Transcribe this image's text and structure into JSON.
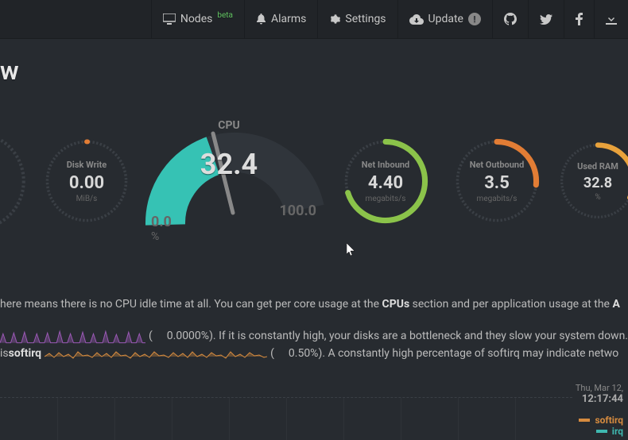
{
  "header": {
    "nodes": "Nodes",
    "nodes_badge": "beta",
    "alarms": "Alarms",
    "settings": "Settings",
    "update": "Update",
    "update_badge": "!"
  },
  "heading": "w",
  "gauges": {
    "disk_write": {
      "title": "Disk Write",
      "value": "0.00",
      "unit": "MiB/s"
    },
    "cpu": {
      "title": "CPU",
      "value": "32.4",
      "min": "0.0",
      "max": "100.0",
      "unit": "%"
    },
    "net_in": {
      "title": "Net Inbound",
      "value": "4.40",
      "unit": "megabits/s"
    },
    "net_out": {
      "title": "Net Outbound",
      "value": "3.5",
      "unit": "megabits/s"
    },
    "ram": {
      "title": "Used RAM",
      "value": "32.8",
      "unit": "%"
    }
  },
  "desc": {
    "line1a": " here means there is no CPU idle time at all. You can get per core usage at the ",
    "line1_link": "CPUs",
    "line1b": " section and per application usage at the ",
    "line2a": " (",
    "line2_val": "0.0000%",
    "line2b": "). If it is constantly high, your disks are a bottleneck and they slow your system down.",
    "line3a": " is ",
    "line3_kw": "softirq",
    "line3b": " (",
    "line3_val": "0.50%",
    "line3c": "). A constantly high percentage of softirq may indicate netwo"
  },
  "timestamp": {
    "date": "Thu, Mar 12,",
    "time": "12:17:44"
  },
  "legend": {
    "a": "softirq",
    "b": "irq"
  },
  "colors": {
    "teal": "#36c2b4",
    "green": "#8bc34a",
    "orange": "#e27d35",
    "amber": "#e8a23c",
    "purple": "#9b59b6",
    "softirq": "#d68b3f",
    "irq": "#3fb8b0"
  },
  "chart_data": [
    {
      "type": "gauge",
      "title": "Disk Write",
      "value": 0.0,
      "unit": "MiB/s",
      "range": [
        0,
        null
      ]
    },
    {
      "type": "gauge",
      "title": "CPU",
      "value": 32.4,
      "unit": "%",
      "range": [
        0,
        100
      ]
    },
    {
      "type": "gauge",
      "title": "Net Inbound",
      "value": 4.4,
      "unit": "megabits/s",
      "range": [
        0,
        null
      ]
    },
    {
      "type": "gauge",
      "title": "Net Outbound",
      "value": 3.5,
      "unit": "megabits/s",
      "range": [
        0,
        null
      ]
    },
    {
      "type": "gauge",
      "title": "Used RAM",
      "value": 32.8,
      "unit": "%",
      "range": [
        0,
        100
      ]
    }
  ]
}
